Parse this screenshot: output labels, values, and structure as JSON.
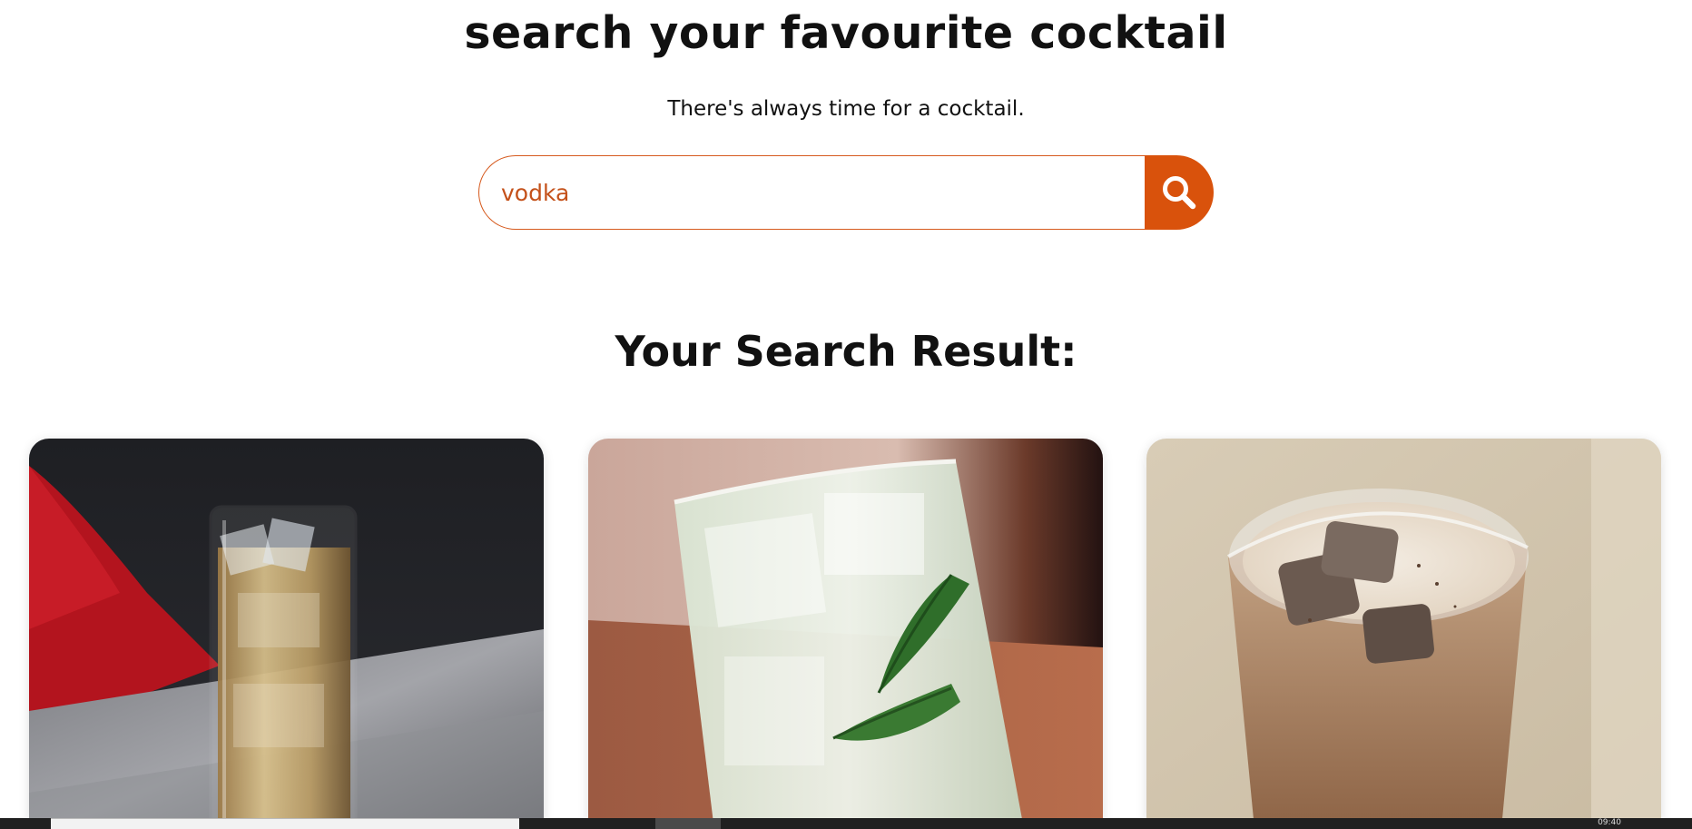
{
  "hero": {
    "title": "search your favourite cocktail",
    "subtitle": "There's always time for a cocktail."
  },
  "search": {
    "value": "vodka",
    "button_icon": "magnifier-icon"
  },
  "results": {
    "heading": "Your Search Result:",
    "cards": [
      {
        "image": "tall-glass-amber-drink-with-ice"
      },
      {
        "image": "rocks-glass-clear-drink-with-mint-and-ice"
      },
      {
        "image": "glass-creamy-coffee-drink-with-ice"
      }
    ]
  },
  "colors": {
    "accent": "#d9520c",
    "input_text": "#c4511a",
    "input_border": "#d65a1e"
  },
  "taskbar": {
    "clock": "09:40"
  }
}
